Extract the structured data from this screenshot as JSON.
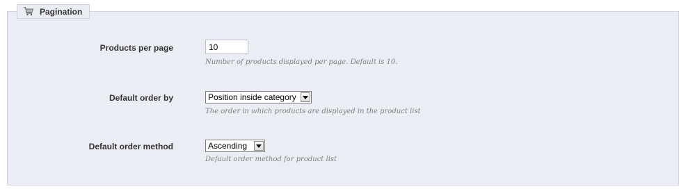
{
  "section": {
    "title": "Pagination",
    "icon": "shopping-cart-icon"
  },
  "fields": [
    {
      "label": "Products per page",
      "value": "10",
      "hint": "Number of products displayed per page. Default is 10."
    },
    {
      "label": "Default order by",
      "value": "Position inside category",
      "hint": "The order in which products are displayed in the product list"
    },
    {
      "label": "Default order method",
      "value": "Ascending",
      "hint": "Default order method for product list"
    }
  ],
  "colors": {
    "panel_background": "#ebedf4",
    "panel_border": "#cfd3de",
    "label_text": "#333333",
    "hint_text": "#7f7f7f"
  }
}
